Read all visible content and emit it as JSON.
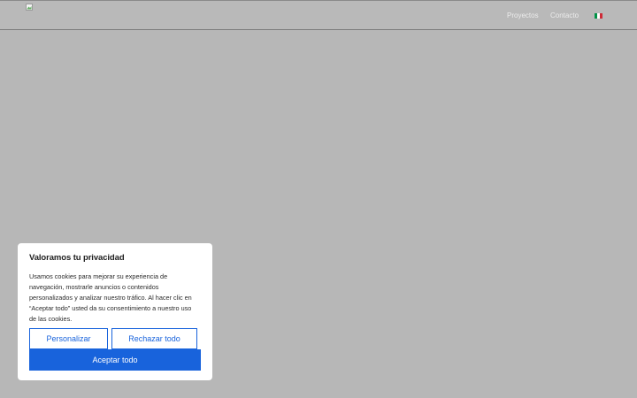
{
  "header": {
    "logo_icon": "broken-image-icon",
    "nav": {
      "proyectos": "Proyectos",
      "contacto": "Contacto"
    },
    "language_flag": {
      "icon": "italy-flag-icon",
      "colors": [
        "#009246",
        "#ffffff",
        "#ce2b37"
      ]
    }
  },
  "cookie_banner": {
    "title": "Valoramos tu privacidad",
    "text": "Usamos cookies para mejorar su experiencia de navegación, mostrarle anuncios o contenidos personalizados y analizar nuestro tráfico. Al hacer clic en “Aceptar todo” usted da su consentimiento a nuestro uso de las cookies.",
    "customize_label": "Personalizar",
    "reject_label": "Rechazar todo",
    "accept_label": "Aceptar todo",
    "accent_color": "#1863dc"
  }
}
